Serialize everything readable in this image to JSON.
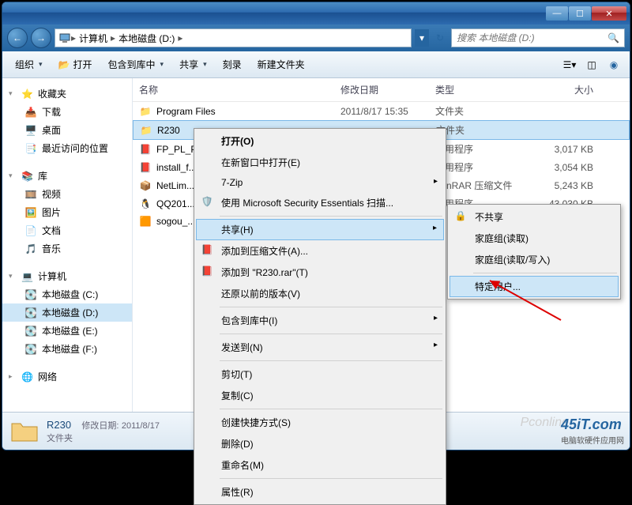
{
  "titlebar": {
    "min": "—",
    "max": "☐",
    "close": "✕"
  },
  "nav": {
    "back": "←",
    "forward": "→",
    "crumbs": [
      "计算机",
      "本地磁盘 (D:)"
    ],
    "search_placeholder": "搜索 本地磁盘 (D:)"
  },
  "toolbar": {
    "organize": "组织",
    "open": "打开",
    "include": "包含到库中",
    "share": "共享",
    "burn": "刻录",
    "newfolder": "新建文件夹"
  },
  "sidebar": {
    "favorites": {
      "label": "收藏夹",
      "items": [
        "下载",
        "桌面",
        "最近访问的位置"
      ]
    },
    "libraries": {
      "label": "库",
      "items": [
        "视频",
        "图片",
        "文档",
        "音乐"
      ]
    },
    "computer": {
      "label": "计算机",
      "items": [
        "本地磁盘 (C:)",
        "本地磁盘 (D:)",
        "本地磁盘 (E:)",
        "本地磁盘 (F:)"
      ]
    },
    "network": {
      "label": "网络"
    }
  },
  "columns": {
    "name": "名称",
    "date": "修改日期",
    "type": "类型",
    "size": "大小"
  },
  "files": [
    {
      "name": "Program Files",
      "date": "2011/8/17 15:35",
      "type": "文件夹",
      "size": "",
      "icon": "folder"
    },
    {
      "name": "R230",
      "date": "",
      "type": "文件夹",
      "size": "",
      "icon": "folder",
      "selected": true
    },
    {
      "name": "FP_PL_P...",
      "date": "",
      "type": "应用程序",
      "size": "3,017 KB",
      "icon": "flash"
    },
    {
      "name": "install_f...",
      "date": "",
      "type": "应用程序",
      "size": "3,054 KB",
      "icon": "flash"
    },
    {
      "name": "NetLim...",
      "date": "",
      "type": "WinRAR 压缩文件",
      "size": "5,243 KB",
      "icon": "rar"
    },
    {
      "name": "QQ201...",
      "date": "",
      "type": "应用程序",
      "size": "43,030 KB",
      "icon": "qq"
    },
    {
      "name": "sogou_...",
      "date": "",
      "type": "",
      "size": "",
      "icon": "sogou"
    }
  ],
  "context": {
    "open": "打开(O)",
    "open_new": "在新窗口中打开(E)",
    "sevenzip": "7-Zip",
    "mse": "使用 Microsoft Security Essentials 扫描...",
    "share": "共享(H)",
    "add_archive": "添加到压缩文件(A)...",
    "add_r230": "添加到 \"R230.rar\"(T)",
    "restore": "还原以前的版本(V)",
    "include_lib": "包含到库中(I)",
    "sendto": "发送到(N)",
    "cut": "剪切(T)",
    "copy": "复制(C)",
    "shortcut": "创建快捷方式(S)",
    "delete": "删除(D)",
    "rename": "重命名(M)",
    "properties": "属性(R)"
  },
  "share_submenu": {
    "noshare": "不共享",
    "home_read": "家庭组(读取)",
    "home_rw": "家庭组(读取/写入)",
    "specific": "特定用户..."
  },
  "detail": {
    "name": "R230",
    "moddate_label": "修改日期:",
    "moddate": "2011/8/17",
    "type": "文件夹"
  },
  "watermarks": {
    "w1": "Pconline",
    "w2": "45iT.com",
    "w2sub": "电脑软硬件应用网"
  }
}
